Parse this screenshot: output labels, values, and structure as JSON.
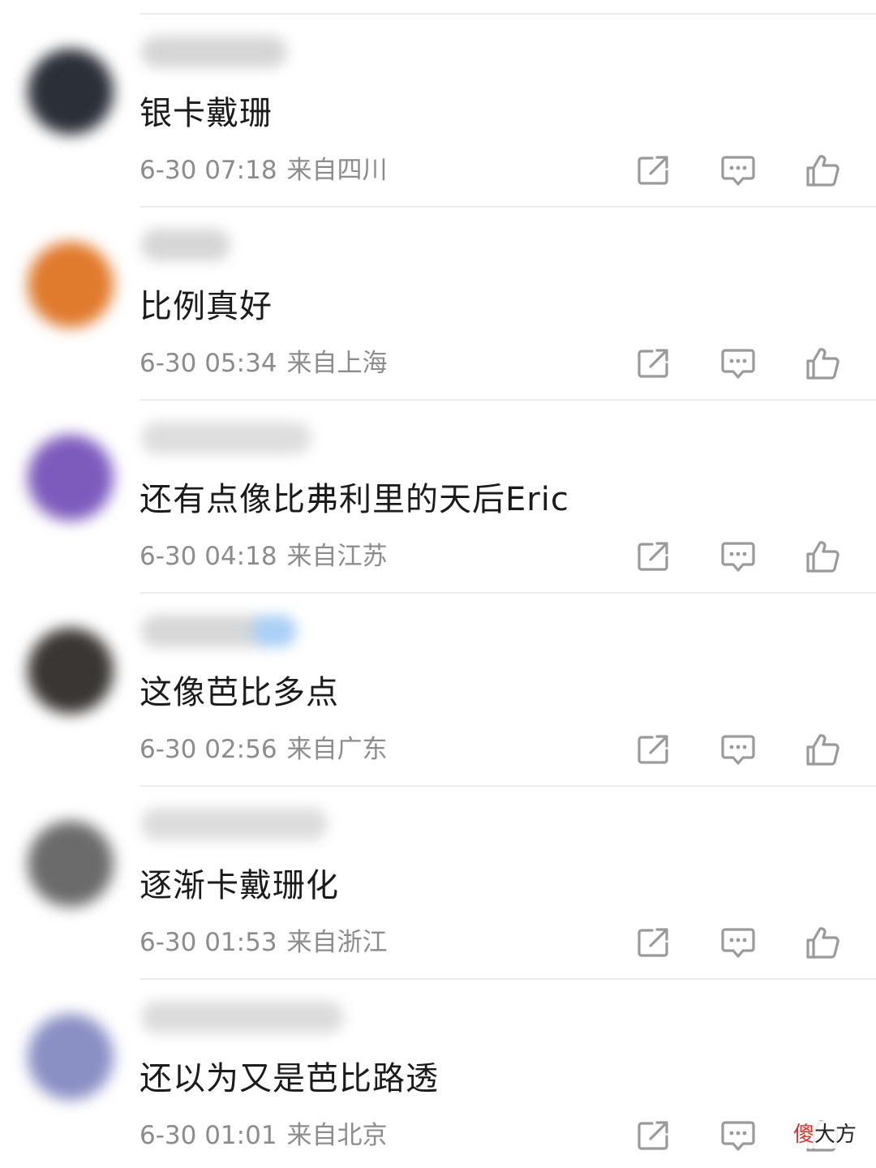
{
  "comments": [
    {
      "text": "银卡戴珊",
      "date": "6-30 07:18",
      "location": "来自四川",
      "avatar_color": "#2b2f38",
      "name_blur_width": 180,
      "name_color": "#cfcfcf",
      "verified_badge": false
    },
    {
      "text": "比例真好",
      "date": "6-30 05:34",
      "location": "来自上海",
      "avatar_color": "#e07a2c",
      "name_blur_width": 110,
      "name_color": "#cfcfcf",
      "verified_badge": false
    },
    {
      "text": "还有点像比弗利里的天后Eric",
      "date": "6-30 04:18",
      "location": "来自江苏",
      "avatar_color": "#7d5bbd",
      "name_blur_width": 210,
      "name_color": "#d8d8d8",
      "verified_badge": false
    },
    {
      "text": "这像芭比多点",
      "date": "6-30 02:56",
      "location": "来自广东",
      "avatar_color": "#3a3633",
      "name_blur_width": 180,
      "name_color": "#d0d0d0",
      "verified_badge": true
    },
    {
      "text": "逐渐卡戴珊化",
      "date": "6-30 01:53",
      "location": "来自浙江",
      "avatar_color": "#6b6b6b",
      "name_blur_width": 230,
      "name_color": "#d6d6d6",
      "verified_badge": false
    },
    {
      "text": "还以为又是芭比路透",
      "date": "6-30 01:01",
      "location": "来自北京",
      "avatar_color": "#8a8fc4",
      "name_blur_width": 250,
      "name_color": "#d6d6d6",
      "verified_badge": false
    }
  ],
  "icons": {
    "share": "share-icon",
    "reply": "comment-icon",
    "like": "thumbs-up-icon"
  },
  "colors": {
    "text_primary": "#1b1b1b",
    "text_secondary": "#8c8c8c",
    "icon": "#9a9a9a",
    "divider": "#ededed"
  },
  "watermark": {
    "accent": "傻",
    "rest": "大方"
  }
}
